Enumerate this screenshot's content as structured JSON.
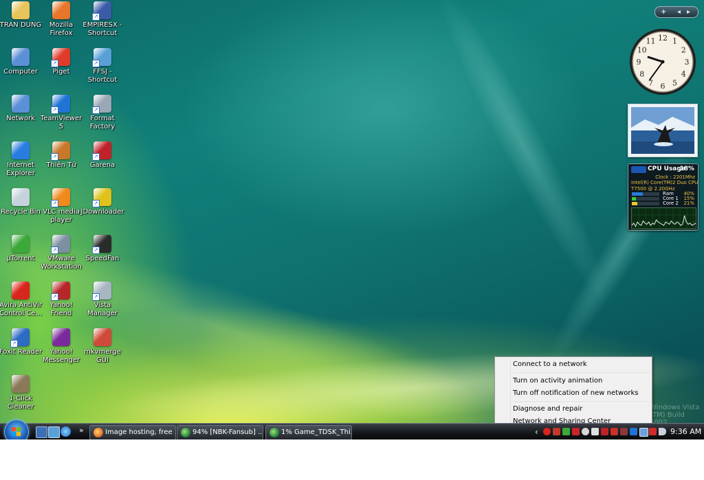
{
  "desktop": {
    "icons": [
      {
        "label": "TRAN DUNG",
        "icon": "folder-icon",
        "color": "#e8c45a"
      },
      {
        "label": "Mozilla Firefox",
        "icon": "firefox-icon",
        "color": "#e8762a"
      },
      {
        "label": "EMPIRESX - Shortcut",
        "icon": "empires-icon",
        "color": "#3b5aa8"
      },
      {
        "label": "Computer",
        "icon": "computer-icon",
        "color": "#5b8fd6"
      },
      {
        "label": "Piget",
        "icon": "piget-icon",
        "color": "#e03a2a"
      },
      {
        "label": "FFSJ - Shortcut",
        "icon": "ffsj-icon",
        "color": "#5aa0d8"
      },
      {
        "label": "Network",
        "icon": "network-icon",
        "color": "#5b8fd6"
      },
      {
        "label": "TeamViewer 5",
        "icon": "teamviewer-icon",
        "color": "#1f74d6"
      },
      {
        "label": "Format Factory",
        "icon": "format-factory-icon",
        "color": "#9aa7b4"
      },
      {
        "label": "Internet Explorer",
        "icon": "internet-explorer-icon",
        "color": "#2a7de0"
      },
      {
        "label": "Thiên Tử",
        "icon": "thien-tu-icon",
        "color": "#c8782a"
      },
      {
        "label": "Garena",
        "icon": "garena-icon",
        "color": "#c0222a"
      },
      {
        "label": "Recycle Bin",
        "icon": "recycle-bin-icon",
        "color": "#c7d3dc"
      },
      {
        "label": "VLC media player",
        "icon": "vlc-icon",
        "color": "#f08a1c"
      },
      {
        "label": "JDownloader",
        "icon": "jdownloader-icon",
        "color": "#e0c21a"
      },
      {
        "label": "µTorrent",
        "icon": "utorrent-icon",
        "color": "#3da83a"
      },
      {
        "label": "VMware Workstation",
        "icon": "vmware-icon",
        "color": "#7c8fa3"
      },
      {
        "label": "SpeedFan",
        "icon": "speedfan-icon",
        "color": "#2b2b2b"
      },
      {
        "label": "Avira AntiVir Control Ce...",
        "icon": "avira-icon",
        "color": "#d9261c"
      },
      {
        "label": "Yahoo! Friend",
        "icon": "yahoo-friend-icon",
        "color": "#b8262a"
      },
      {
        "label": "Vista Manager",
        "icon": "vista-manager-icon",
        "color": "#a8b6c4"
      },
      {
        "label": "Foxit Reader",
        "icon": "foxit-reader-icon",
        "color": "#2d6bc4"
      },
      {
        "label": "Yahoo! Messenger",
        "icon": "yahoo-messenger-icon",
        "color": "#7a2a9c"
      },
      {
        "label": "mkvmerge GUI",
        "icon": "mkvmerge-icon",
        "color": "#d04a3a"
      },
      {
        "label": "1-Click Cleaner",
        "icon": "cleaner-icon",
        "color": "#8a7a5a"
      }
    ],
    "watermark": "Windows Vista (TM) Build 6002"
  },
  "gadgets": {
    "bar_plus": "+",
    "bar_prev": "◂",
    "bar_next": "▸",
    "clock": {
      "numbers": [
        "12",
        "1",
        "2",
        "3",
        "4",
        "5",
        "6",
        "7",
        "8",
        "9",
        "10",
        "11"
      ],
      "time_label": "9:36"
    },
    "cpu": {
      "title": "CPU Usage",
      "percent": "18%",
      "clock": "Clock : 2201Mhz",
      "model": "Intel(R) Core(TM)2 Duo CPU",
      "model_line2": "T7500 @ 2.20GHz",
      "rows": [
        {
          "label": "Ram",
          "value": "40%",
          "level": 40
        },
        {
          "label": "Core 1",
          "value": "15%",
          "level": 15
        },
        {
          "label": "Core 2",
          "value": "21%",
          "level": 21
        }
      ],
      "graph": [
        3,
        5,
        2,
        6,
        4,
        3,
        7,
        5,
        4,
        6,
        3,
        5,
        4,
        8,
        6,
        5,
        4,
        3,
        6,
        5,
        4,
        7,
        5,
        4,
        6,
        5,
        3,
        4,
        12,
        6,
        4,
        5,
        3,
        4,
        5
      ]
    }
  },
  "taskbar": {
    "tasks": [
      {
        "label": "Image hosting, free ...",
        "icon": "firefox-icon"
      },
      {
        "label": "94% [NBK-Fansub] ...",
        "icon": "globe-download-icon"
      },
      {
        "label": "1% Game_TDSK_Thi...",
        "icon": "globe-download-icon"
      }
    ],
    "quick_launch_overflow": "»",
    "tray_expand": "‹",
    "time": "9:36 AM"
  },
  "context_menu": {
    "items": [
      "Connect to a network",
      "Turn on activity animation",
      "Turn off notification of new networks",
      "Diagnose and repair",
      "Network and Sharing Center"
    ]
  },
  "colors": {
    "menu_bg": "#f0f0f0",
    "taskbar": "#171a1e",
    "accent": "#1c61b9"
  }
}
